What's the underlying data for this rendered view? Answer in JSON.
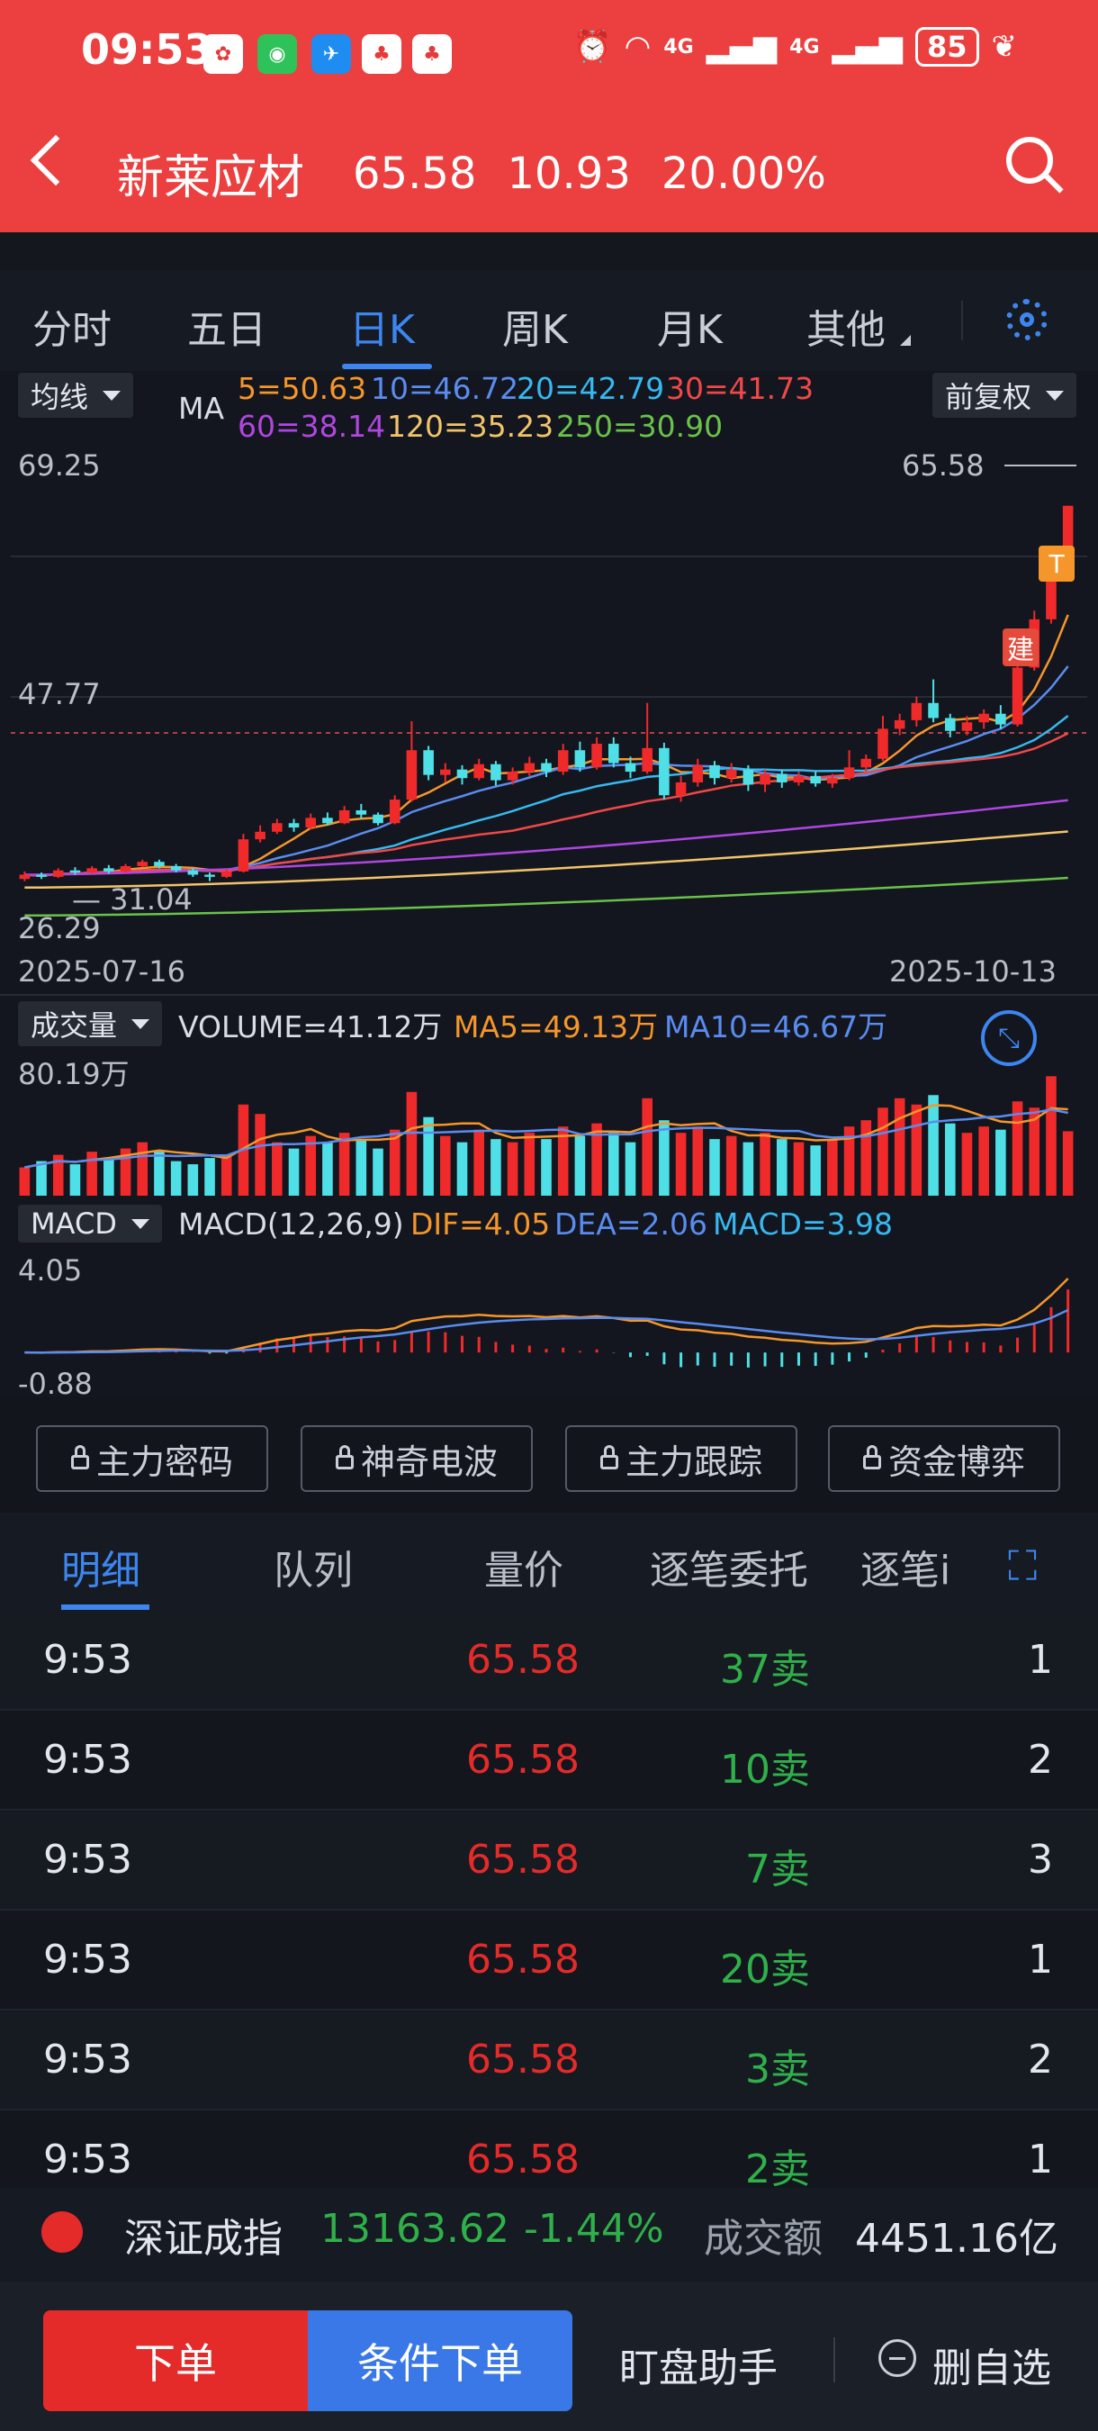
{
  "status_bar": {
    "time": "09:53",
    "signal_1": "4G",
    "signal_2": "4G",
    "battery": "85"
  },
  "header": {
    "name": "新莱应材",
    "price": "65.58",
    "change": "10.93",
    "change_pct": "20.00%"
  },
  "period_tabs": [
    "分时",
    "五日",
    "日K",
    "周K",
    "月K",
    "其他"
  ],
  "active_tab": "日K",
  "ma_panel": {
    "indicator": "均线",
    "label": "MA",
    "ma5": "5=50.63",
    "ma10": "10=46.72",
    "ma20": "20=42.79",
    "ma30": "30=41.73",
    "ma60": "60=38.14",
    "ma120": "120=35.23",
    "ma250": "250=30.90",
    "adjust": "前复权",
    "y_top": "69.25",
    "y_mid": "47.77",
    "y_low": "26.29",
    "low_mark": "31.04",
    "high_mark": "65.58",
    "date_start": "2025-07-16",
    "date_end": "2025-10-13",
    "tag_t": "T",
    "tag_build": "建"
  },
  "volume_panel": {
    "indicator": "成交量",
    "volume": "VOLUME=41.12万",
    "ma5": "MA5=49.13万",
    "ma10": "MA10=46.67万",
    "y_top": "80.19万"
  },
  "macd_panel": {
    "indicator": "MACD",
    "params": "MACD(12,26,9)",
    "dif": "DIF=4.05",
    "dea": "DEA=2.06",
    "macd": "MACD=3.98",
    "y_top": "4.05",
    "y_bottom": "-0.88"
  },
  "locked_tools": [
    "主力密码",
    "神奇电波",
    "主力跟踪",
    "资金博弈"
  ],
  "detail_tabs": [
    "明细",
    "队列",
    "量价",
    "逐笔委托",
    "逐笔i"
  ],
  "detail_rows": [
    {
      "time": "9:53",
      "price": "65.58",
      "qty": "37卖",
      "n": "1"
    },
    {
      "time": "9:53",
      "price": "65.58",
      "qty": "10卖",
      "n": "2"
    },
    {
      "time": "9:53",
      "price": "65.58",
      "qty": "7卖",
      "n": "3"
    },
    {
      "time": "9:53",
      "price": "65.58",
      "qty": "20卖",
      "n": "1"
    },
    {
      "time": "9:53",
      "price": "65.58",
      "qty": "3卖",
      "n": "2"
    },
    {
      "time": "9:53",
      "price": "65.58",
      "qty": "2卖",
      "n": "1"
    }
  ],
  "index_bar": {
    "name": "深证成指",
    "value": "13163.62",
    "pct": "-1.44%",
    "turnover_label": "成交额",
    "turnover": "4451.16亿"
  },
  "bottom": {
    "order": "下单",
    "cond_order": "条件下单",
    "assistant": "盯盘助手",
    "remove": "删自选"
  },
  "chart_data": {
    "type": "candlestick",
    "x_range": [
      "2025-07-16",
      "2025-10-13"
    ],
    "y_range": [
      26.29,
      69.25
    ],
    "last_close": 65.58,
    "ma_lines": [
      {
        "name": "MA5",
        "value": 50.63,
        "color": "#f5962b"
      },
      {
        "name": "MA10",
        "value": 46.72,
        "color": "#5a8cf0"
      },
      {
        "name": "MA20",
        "value": 42.79,
        "color": "#37b8f0"
      },
      {
        "name": "MA30",
        "value": 41.73,
        "color": "#f04848"
      },
      {
        "name": "MA60",
        "value": 38.14,
        "color": "#b046e0"
      },
      {
        "name": "MA120",
        "value": 35.23,
        "color": "#f2c46a"
      },
      {
        "name": "MA250",
        "value": 30.9,
        "color": "#6ac24a"
      }
    ],
    "candles": [
      [
        30.8,
        31.2,
        31.5,
        30.6
      ],
      [
        31.2,
        31.0,
        31.4,
        30.8
      ],
      [
        31.0,
        31.6,
        31.8,
        30.9
      ],
      [
        31.6,
        31.4,
        31.9,
        31.2
      ],
      [
        31.4,
        31.8,
        32.0,
        31.3
      ],
      [
        31.8,
        31.5,
        32.1,
        31.3
      ],
      [
        31.5,
        32.0,
        32.2,
        31.4
      ],
      [
        32.0,
        32.4,
        32.6,
        31.9
      ],
      [
        32.4,
        32.0,
        32.6,
        31.8
      ],
      [
        32.0,
        31.6,
        32.2,
        31.4
      ],
      [
        31.6,
        31.2,
        31.8,
        31.0
      ],
      [
        31.2,
        31.0,
        31.4,
        30.6
      ],
      [
        31.0,
        31.5,
        31.7,
        30.9
      ],
      [
        31.5,
        34.5,
        35.0,
        31.4
      ],
      [
        34.5,
        35.2,
        35.8,
        34.2
      ],
      [
        35.2,
        36.0,
        36.4,
        35.0
      ],
      [
        36.0,
        35.6,
        36.4,
        35.2
      ],
      [
        35.6,
        36.5,
        36.9,
        35.4
      ],
      [
        36.5,
        36.0,
        37.0,
        35.8
      ],
      [
        36.0,
        37.2,
        37.6,
        35.9
      ],
      [
        37.2,
        36.8,
        37.8,
        36.4
      ],
      [
        36.8,
        36.0,
        37.0,
        35.8
      ],
      [
        36.0,
        38.2,
        38.6,
        35.9
      ],
      [
        38.2,
        42.8,
        45.5,
        38.0
      ],
      [
        42.8,
        40.5,
        43.2,
        40.0
      ],
      [
        40.5,
        41.0,
        41.6,
        39.8
      ],
      [
        41.0,
        40.2,
        41.4,
        39.6
      ],
      [
        40.2,
        41.5,
        42.0,
        40.0
      ],
      [
        41.5,
        40.0,
        41.8,
        39.5
      ],
      [
        40.0,
        40.8,
        41.2,
        39.6
      ],
      [
        40.8,
        41.6,
        42.2,
        40.4
      ],
      [
        41.6,
        40.8,
        42.0,
        40.3
      ],
      [
        40.8,
        42.8,
        43.4,
        40.5
      ],
      [
        42.8,
        41.2,
        43.6,
        40.8
      ],
      [
        41.2,
        43.4,
        44.0,
        41.0
      ],
      [
        43.4,
        41.6,
        44.0,
        41.2
      ],
      [
        41.6,
        40.8,
        42.2,
        40.2
      ],
      [
        40.8,
        43.0,
        47.2,
        40.6
      ],
      [
        43.0,
        38.6,
        43.5,
        38.2
      ],
      [
        38.6,
        39.8,
        40.4,
        38.0
      ],
      [
        39.8,
        41.4,
        42.0,
        39.4
      ],
      [
        41.4,
        40.2,
        41.8,
        39.6
      ],
      [
        40.2,
        41.0,
        41.6,
        39.8
      ],
      [
        41.0,
        39.6,
        41.4,
        39.0
      ],
      [
        39.6,
        40.6,
        41.0,
        38.9
      ],
      [
        40.6,
        39.8,
        41.0,
        39.3
      ],
      [
        39.8,
        40.4,
        40.8,
        39.5
      ],
      [
        40.4,
        39.7,
        40.8,
        39.4
      ],
      [
        39.7,
        40.2,
        40.6,
        39.3
      ],
      [
        40.2,
        41.2,
        42.8,
        40.0
      ],
      [
        41.2,
        42.0,
        42.4,
        40.8
      ],
      [
        42.0,
        44.8,
        46.0,
        41.8
      ],
      [
        44.8,
        45.6,
        46.2,
        44.2
      ],
      [
        45.6,
        47.2,
        47.8,
        45.0
      ],
      [
        47.2,
        45.8,
        49.4,
        45.4
      ],
      [
        45.8,
        44.6,
        46.2,
        44.0
      ],
      [
        44.6,
        45.4,
        46.0,
        44.2
      ],
      [
        45.4,
        46.2,
        46.6,
        44.8
      ],
      [
        46.2,
        45.2,
        47.0,
        44.8
      ],
      [
        45.2,
        50.5,
        51.0,
        45.0
      ],
      [
        50.5,
        55.0,
        55.8,
        50.2
      ],
      [
        55.0,
        60.8,
        61.2,
        54.6
      ],
      [
        60.8,
        65.58,
        65.58,
        60.5
      ]
    ],
    "volume_max": 80.19,
    "volumes": [
      18,
      22,
      26,
      20,
      28,
      24,
      30,
      34,
      28,
      22,
      20,
      24,
      26,
      58,
      52,
      34,
      30,
      38,
      34,
      40,
      36,
      30,
      42,
      66,
      50,
      38,
      34,
      42,
      36,
      34,
      40,
      36,
      44,
      38,
      46,
      40,
      34,
      62,
      48,
      40,
      44,
      36,
      38,
      34,
      40,
      36,
      34,
      32,
      36,
      44,
      48,
      56,
      62,
      58,
      64,
      46,
      40,
      44,
      42,
      60,
      56,
      76,
      41
    ],
    "volume_ma5": 49.13,
    "volume_ma10": 46.67,
    "macd": {
      "dif": 4.05,
      "dea": 2.06,
      "macd": 3.98,
      "y_range": [
        -0.88,
        4.05
      ]
    }
  }
}
